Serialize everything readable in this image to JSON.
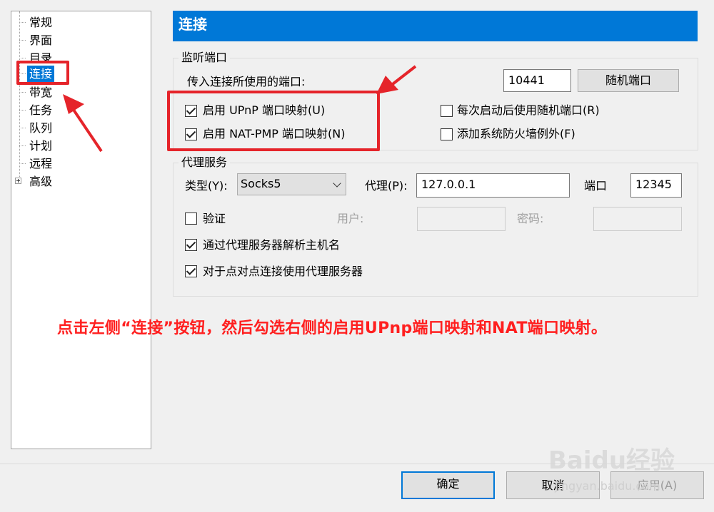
{
  "tree": {
    "items": [
      {
        "label": "常规"
      },
      {
        "label": "界面"
      },
      {
        "label": "目录"
      },
      {
        "label": "连接"
      },
      {
        "label": "带宽"
      },
      {
        "label": "任务"
      },
      {
        "label": "队列"
      },
      {
        "label": "计划"
      },
      {
        "label": "远程"
      },
      {
        "label": "高级"
      }
    ],
    "selected_index": 3
  },
  "page": {
    "title": "连接"
  },
  "listen_port": {
    "group_title": "监听端口",
    "port_label": "传入连接所使用的端口:",
    "port_value": "10441",
    "random_button": "随机端口",
    "upnp_label": "启用 UPnP 端口映射(U)",
    "upnp_checked": true,
    "natpmp_label": "启用 NAT-PMP 端口映射(N)",
    "natpmp_checked": true,
    "random_each_start_label": "每次启动后使用随机端口(R)",
    "random_each_start_checked": false,
    "firewall_label": "添加系统防火墙例外(F)",
    "firewall_checked": false
  },
  "proxy": {
    "group_title": "代理服务",
    "type_label": "类型(Y):",
    "type_value": "Socks5",
    "proxy_label": "代理(P):",
    "proxy_value": "127.0.0.1",
    "port_label": "端口",
    "port_value": "12345",
    "auth_label": "验证",
    "auth_checked": false,
    "user_label": "用户:",
    "password_label": "密码:",
    "resolve_hostname_label": "通过代理服务器解析主机名",
    "resolve_hostname_checked": true,
    "p2p_label": "对于点对点连接使用代理服务器",
    "p2p_checked": true
  },
  "footer": {
    "ok_button": "确定",
    "cancel_button": "取消",
    "apply_button": "应用(A)"
  },
  "annotation": {
    "instruction": "点击左侧“连接”按钮，然后勾选右侧的启用UPnp端口映射和NAT端口映射。",
    "color": "#e5242a"
  },
  "watermark": {
    "text": "Baidu经验",
    "sub": "jingyan.baidu.com"
  },
  "colors": {
    "accent": "#0078d7",
    "annotation_red": "#e5242a"
  }
}
